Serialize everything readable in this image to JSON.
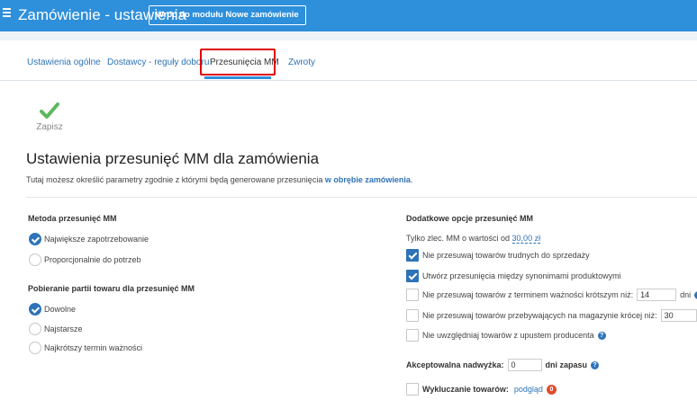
{
  "header": {
    "title": "Zamówienie - ustawienia",
    "back_button": "Wróć do modułu Nowe zamówienie"
  },
  "tabs": [
    {
      "label": "Ustawienia ogólne",
      "active": false
    },
    {
      "label": "Dostawcy - reguły doboru",
      "active": false
    },
    {
      "label": "Przesunięcia MM",
      "active": true
    },
    {
      "label": "Zwroty",
      "active": false
    }
  ],
  "toolbar": {
    "save_label": "Zapisz",
    "save_icon": "check-icon"
  },
  "page": {
    "title": "Ustawienia przesunięć MM dla zamówienia",
    "description_prefix": "Tutaj możesz określić parametry zgodnie z którymi będą generowane przesunięcia ",
    "description_emph": "w obrębie zamówienia",
    "description_suffix": "."
  },
  "method": {
    "title": "Metoda przesunięć MM",
    "options": [
      {
        "label": "Największe zapotrzebowanie",
        "checked": true
      },
      {
        "label": "Proporcjonalnie do potrzeb",
        "checked": false
      }
    ]
  },
  "batch": {
    "title": "Pobieranie partii towaru dla przesunięć MM",
    "options": [
      {
        "label": "Dowolne",
        "checked": true
      },
      {
        "label": "Najstarsze",
        "checked": false
      },
      {
        "label": "Najkrótszy termin ważności",
        "checked": false
      }
    ]
  },
  "extra": {
    "title": "Dodatkowe opcje przesunięć MM",
    "min_value_label": "Tylko zlec. MM o wartości od",
    "min_value": "30,00 zł",
    "options": [
      {
        "label": "Nie przesuwaj towarów trudnych do sprzedaży",
        "checked": true
      },
      {
        "label": "Utwórz przesunięcia między synonimami produktowymi",
        "checked": true
      },
      {
        "label": "Nie przesuwaj towarów z terminem ważności krótszym niż:",
        "checked": false,
        "value": "14",
        "suffix": "dni"
      },
      {
        "label": "Nie przesuwaj towarów przebywających na magazynie krócej niż:",
        "checked": false,
        "value": "30",
        "suffix": "dni"
      },
      {
        "label": "Nie uwzględniaj towarów z upustem producenta",
        "checked": false
      }
    ],
    "overstock_label": "Akceptowalna nadwyżka:",
    "overstock_value": "0",
    "overstock_suffix": "dni zapasu",
    "exclusion_label": "Wykluczanie towarów:",
    "exclusion_link": "podgląd",
    "exclusion_count": "0"
  },
  "colors": {
    "accent": "#2e8fdb",
    "link": "#2e73b8",
    "highlight": "#e00000",
    "success": "#5cb85c",
    "badge": "#e04b2f"
  }
}
